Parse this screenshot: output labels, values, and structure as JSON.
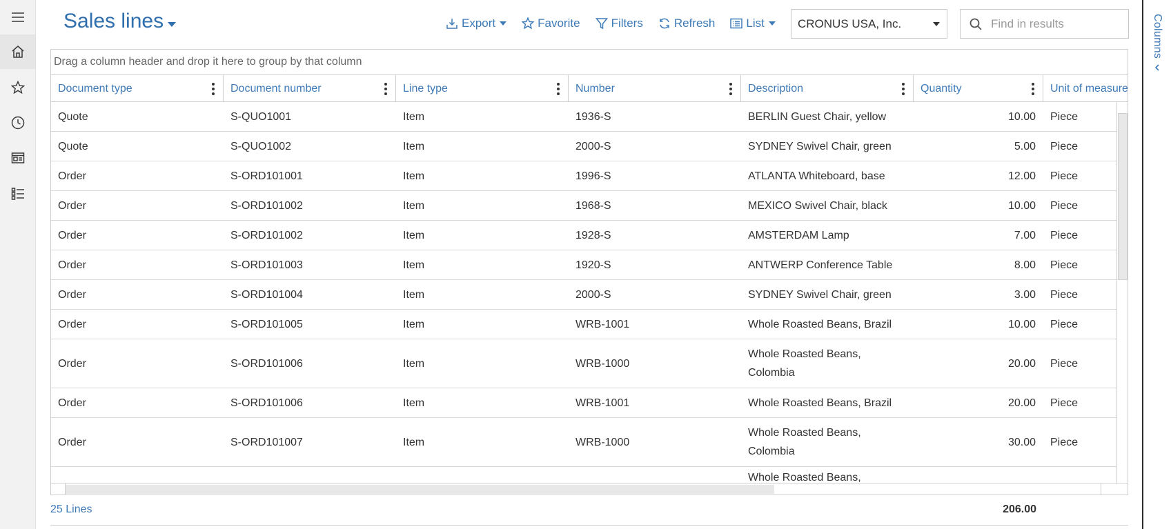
{
  "page": {
    "title": "Sales lines"
  },
  "toolbar": {
    "export_label": "Export",
    "favorite_label": "Favorite",
    "filters_label": "Filters",
    "refresh_label": "Refresh",
    "list_label": "List"
  },
  "company": {
    "selected": "CRONUS USA, Inc."
  },
  "search": {
    "placeholder": "Find in results",
    "value": ""
  },
  "side_panel": {
    "columns_label": "Columns"
  },
  "grid": {
    "group_hint": "Drag a column header and drop it here to group by that column",
    "columns": [
      "Document type",
      "Document number",
      "Line type",
      "Number",
      "Description",
      "Quantity",
      "Unit of measure"
    ],
    "rows": [
      [
        "Quote",
        "S-QUO1001",
        "Item",
        "1936-S",
        "BERLIN Guest Chair, yellow",
        "10.00",
        "Piece"
      ],
      [
        "Quote",
        "S-QUO1002",
        "Item",
        "2000-S",
        "SYDNEY Swivel Chair, green",
        "5.00",
        "Piece"
      ],
      [
        "Order",
        "S-ORD101001",
        "Item",
        "1996-S",
        "ATLANTA Whiteboard, base",
        "12.00",
        "Piece"
      ],
      [
        "Order",
        "S-ORD101002",
        "Item",
        "1968-S",
        "MEXICO Swivel Chair, black",
        "10.00",
        "Piece"
      ],
      [
        "Order",
        "S-ORD101002",
        "Item",
        "1928-S",
        "AMSTERDAM Lamp",
        "7.00",
        "Piece"
      ],
      [
        "Order",
        "S-ORD101003",
        "Item",
        "1920-S",
        "ANTWERP Conference Table",
        "8.00",
        "Piece"
      ],
      [
        "Order",
        "S-ORD101004",
        "Item",
        "2000-S",
        "SYDNEY Swivel Chair, green",
        "3.00",
        "Piece"
      ],
      [
        "Order",
        "S-ORD101005",
        "Item",
        "WRB-1001",
        "Whole Roasted Beans, Brazil",
        "10.00",
        "Piece"
      ],
      [
        "Order",
        "S-ORD101006",
        "Item",
        "WRB-1000",
        "Whole Roasted Beans, Colombia",
        "20.00",
        "Piece"
      ],
      [
        "Order",
        "S-ORD101006",
        "Item",
        "WRB-1001",
        "Whole Roasted Beans, Brazil",
        "20.00",
        "Piece"
      ],
      [
        "Order",
        "S-ORD101007",
        "Item",
        "WRB-1000",
        "Whole Roasted Beans, Colombia",
        "30.00",
        "Piece"
      ],
      [
        "",
        "",
        "",
        "",
        "Whole Roasted Beans,",
        "",
        ""
      ]
    ]
  },
  "footer": {
    "lines_count": "25 Lines",
    "total_quantity": "206.00"
  },
  "icons": {
    "nav": [
      "hamburger-icon",
      "home-icon",
      "star-icon",
      "clock-icon",
      "workspace-icon",
      "list-icon"
    ]
  },
  "colors": {
    "accent": "#3d7ab8",
    "title": "#2f6fae",
    "border": "#cfcfcf",
    "rail": "#f2f2f2"
  }
}
